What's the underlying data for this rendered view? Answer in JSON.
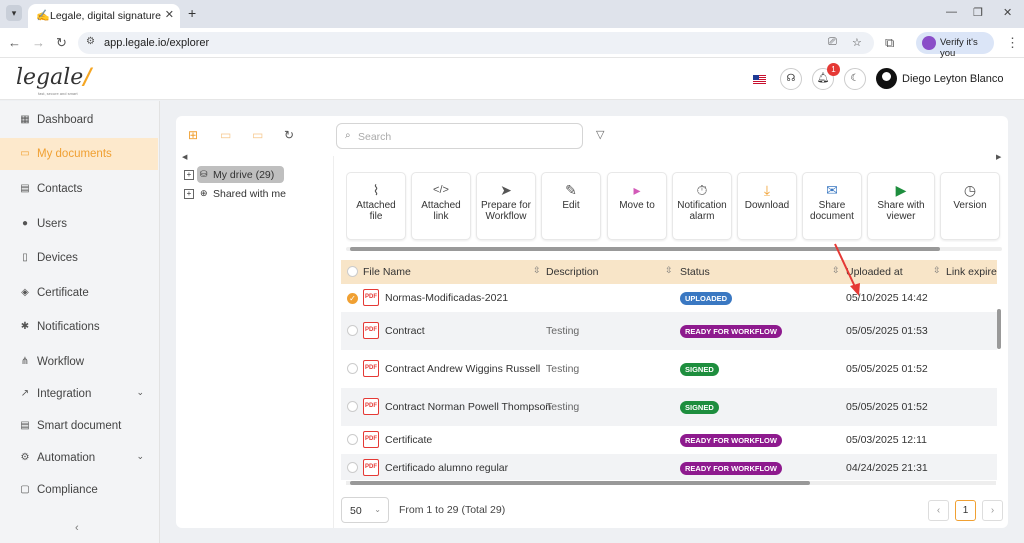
{
  "browser": {
    "tab_title": "Legale, digital signature",
    "url": "app.legale.io/explorer",
    "verify_label": "Verify it's you"
  },
  "header": {
    "logo_text": "legale",
    "logo_mark": "/",
    "tagline": "fast, secure and smart",
    "notification_count": "1",
    "user_name": "Diego Leyton Blanco"
  },
  "sidebar": {
    "items": [
      {
        "label": "Dashboard",
        "icon": "▦"
      },
      {
        "label": "My documents",
        "icon": "▭"
      },
      {
        "label": "Contacts",
        "icon": "▤"
      },
      {
        "label": "Users",
        "icon": "●"
      },
      {
        "label": "Devices",
        "icon": "▯"
      },
      {
        "label": "Certificate",
        "icon": "◈"
      },
      {
        "label": "Notifications",
        "icon": "✱"
      },
      {
        "label": "Workflow",
        "icon": "⋔"
      },
      {
        "label": "Integration",
        "icon": "↗"
      },
      {
        "label": "Smart document",
        "icon": "▤"
      },
      {
        "label": "Automation",
        "icon": "⚙"
      },
      {
        "label": "Compliance",
        "icon": "▢"
      }
    ],
    "collapse_icon": "‹"
  },
  "explorer": {
    "search_placeholder": "Search",
    "tree": [
      {
        "label": "My drive (29)"
      },
      {
        "label": "Shared with me"
      }
    ],
    "actions": [
      {
        "label": "Attached file",
        "icon": "📎"
      },
      {
        "label": "Attached link",
        "icon": "</>"
      },
      {
        "label": "Prepare for Workflow",
        "icon": "➤"
      },
      {
        "label": "Edit",
        "icon": "✎"
      },
      {
        "label": "Move to",
        "icon": "▸"
      },
      {
        "label": "Notification alarm",
        "icon": "⏱"
      },
      {
        "label": "Download",
        "icon": "⤓"
      },
      {
        "label": "Share document",
        "icon": "✉"
      },
      {
        "label": "Share with viewer",
        "icon": "▶"
      },
      {
        "label": "Version",
        "icon": "◷"
      }
    ],
    "columns": [
      "File Name",
      "Description",
      "Status",
      "Uploaded at",
      "Link expire"
    ],
    "rows": [
      {
        "name": "Normas-Modificadas-2021",
        "description": "",
        "status": "UPLOADED",
        "uploaded": "05/10/2025 14:42",
        "checked": true
      },
      {
        "name": "Contract",
        "description": "Testing",
        "status": "READY FOR WORKFLOW",
        "uploaded": "05/05/2025 01:53",
        "checked": false
      },
      {
        "name": "Contract Andrew Wiggins Russell",
        "description": "Testing",
        "status": "SIGNED",
        "uploaded": "05/05/2025 01:52",
        "checked": false
      },
      {
        "name": "Contract Norman Powell Thompson",
        "description": "Testing",
        "status": "SIGNED",
        "uploaded": "05/05/2025 01:52",
        "checked": false
      },
      {
        "name": "Certificate",
        "description": "",
        "status": "READY FOR WORKFLOW",
        "uploaded": "05/03/2025 12:11",
        "checked": false
      },
      {
        "name": "Certificado alumno regular",
        "description": "",
        "status": "READY FOR WORKFLOW",
        "uploaded": "04/24/2025 21:31",
        "checked": false
      }
    ],
    "status_colors": {
      "UPLOADED": "#3a78c2",
      "READY FOR WORKFLOW": "#8e1a8e",
      "SIGNED": "#1e8e3e"
    },
    "page_size": "50",
    "pagination_info": "From 1 to 29 (Total 29)",
    "current_page": "1"
  },
  "colors": {
    "accent": "#f0a032",
    "header_row": "#f8e5c8",
    "active_sidebar": "#fde9cc",
    "arrow": "#e53935"
  }
}
